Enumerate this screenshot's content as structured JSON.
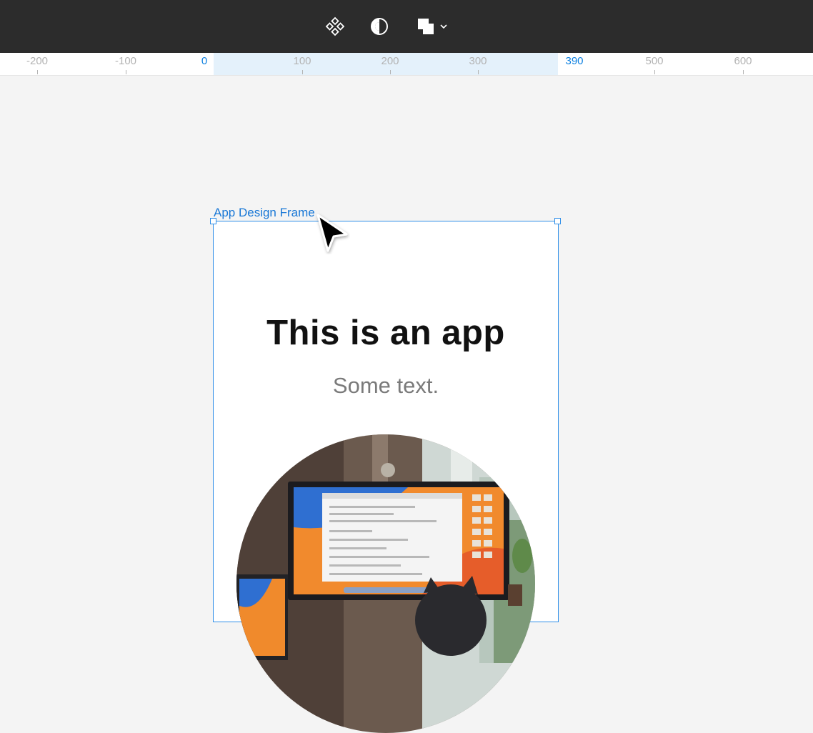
{
  "toolbar": {
    "tools": [
      "component-icon",
      "contrast-icon",
      "boolean-operation-icon",
      "chevron-down-icon"
    ]
  },
  "ruler": {
    "ticks": [
      "-200",
      "-100",
      "0",
      "100",
      "200",
      "300",
      "390",
      "500",
      "600"
    ],
    "selection_range": [
      "0",
      "390"
    ],
    "accent": "#0d80e0"
  },
  "frame": {
    "label": "App Design Frame",
    "title": "This is an app",
    "subtitle": "Some text.",
    "image": "circular photo of a desk with a monitor and a cat"
  },
  "colors": {
    "toolbar_bg": "#2c2c2c",
    "canvas_bg": "#f4f4f4",
    "selection": "#2e8ee8"
  }
}
